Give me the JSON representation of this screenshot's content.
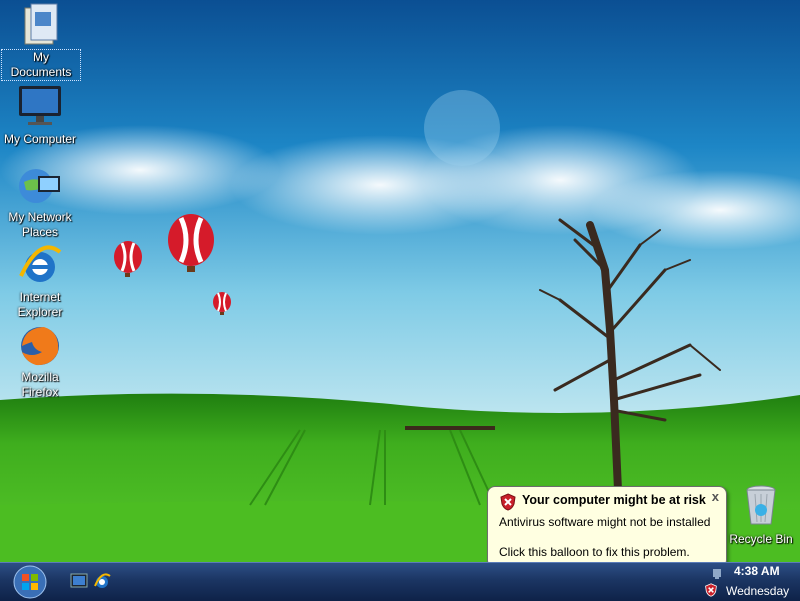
{
  "desktop": {
    "icons": [
      {
        "label": "My Documents",
        "icon": "my-documents-icon"
      },
      {
        "label": "My Computer",
        "icon": "my-computer-icon"
      },
      {
        "label": "My Network Places",
        "icon": "network-places-icon"
      },
      {
        "label": "Internet Explorer",
        "icon": "internet-explorer-icon"
      },
      {
        "label": "Mozilla Firefox",
        "icon": "firefox-icon"
      },
      {
        "label": "Recycle Bin",
        "icon": "recycle-bin-icon"
      }
    ]
  },
  "balloon": {
    "title": "Your computer might be at risk",
    "line1": "Antivirus software might not be installed",
    "line2": "Click this balloon to fix this problem.",
    "close": "x"
  },
  "taskbar": {
    "clock_time": "4:38 AM",
    "clock_day": "Wednesday"
  },
  "colors": {
    "taskbar": "#1b3563",
    "balloon_bg": "#ffffe1",
    "sky": "#1d86c6",
    "grass": "#3fae1e"
  }
}
